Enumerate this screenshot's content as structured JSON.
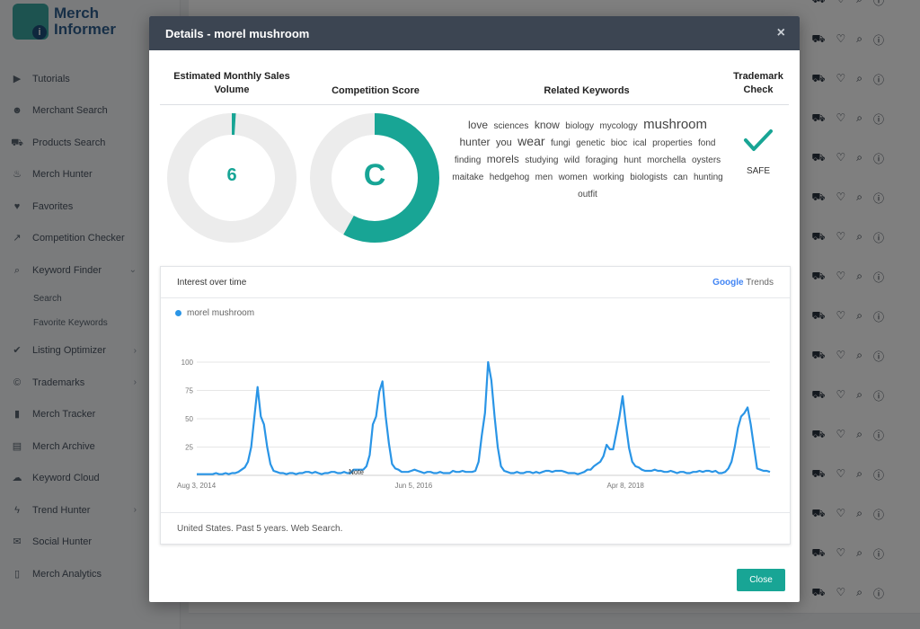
{
  "app": {
    "logo_line1": "Merch",
    "logo_line2": "Informer"
  },
  "sidebar": {
    "items": [
      {
        "label": "Tutorials",
        "icon": "video-icon"
      },
      {
        "label": "Merchant Search",
        "icon": "users-icon"
      },
      {
        "label": "Products Search",
        "icon": "cart-icon"
      },
      {
        "label": "Merch Hunter",
        "icon": "fire-icon"
      },
      {
        "label": "Favorites",
        "icon": "heart-icon"
      },
      {
        "label": "Competition Checker",
        "icon": "chart-line-icon"
      },
      {
        "label": "Keyword Finder",
        "icon": "search-icon",
        "arrow": "⌄"
      },
      {
        "label": "Listing Optimizer",
        "icon": "check-icon",
        "arrow": "›"
      },
      {
        "label": "Trademarks",
        "icon": "copyright-icon",
        "arrow": "›"
      },
      {
        "label": "Merch Tracker",
        "icon": "bar-chart-icon"
      },
      {
        "label": "Merch Archive",
        "icon": "archive-icon"
      },
      {
        "label": "Keyword Cloud",
        "icon": "cloud-icon"
      },
      {
        "label": "Trend Hunter",
        "icon": "bolt-icon",
        "arrow": "›"
      },
      {
        "label": "Social Hunter",
        "icon": "comments-icon"
      },
      {
        "label": "Merch Analytics",
        "icon": "book-icon"
      }
    ],
    "sub_items": [
      "Search",
      "Favorite Keywords"
    ]
  },
  "modal": {
    "title": "Details - morel mushroom",
    "close_icon": "×",
    "col_sales": "Estimated Monthly Sales Volume",
    "col_competition": "Competition Score",
    "col_keywords": "Related Keywords",
    "col_trademark": "Trademark Check",
    "sales_value": "6",
    "sales_fraction": 0.01,
    "competition_value": "C",
    "competition_fraction": 0.58,
    "keywords": [
      {
        "w": "love",
        "s": 12
      },
      {
        "w": "sciences",
        "s": 10
      },
      {
        "w": "know",
        "s": 12
      },
      {
        "w": "biology",
        "s": 10
      },
      {
        "w": "mycology",
        "s": 10
      },
      {
        "w": "mushroom",
        "s": 15
      },
      {
        "w": "hunter",
        "s": 12
      },
      {
        "w": "you",
        "s": 11
      },
      {
        "w": "wear",
        "s": 14
      },
      {
        "w": "fungi",
        "s": 10
      },
      {
        "w": "genetic",
        "s": 10
      },
      {
        "w": "bioc",
        "s": 10
      },
      {
        "w": "ical",
        "s": 10
      },
      {
        "w": "properties",
        "s": 10
      },
      {
        "w": "fond",
        "s": 10
      },
      {
        "w": "finding",
        "s": 10
      },
      {
        "w": "morels",
        "s": 12
      },
      {
        "w": "studying",
        "s": 10
      },
      {
        "w": "wild",
        "s": 10
      },
      {
        "w": "foraging",
        "s": 10
      },
      {
        "w": "hunt",
        "s": 10
      },
      {
        "w": "morchella",
        "s": 10
      },
      {
        "w": "oysters",
        "s": 10
      },
      {
        "w": "maitake",
        "s": 10
      },
      {
        "w": "hedgehog",
        "s": 10
      },
      {
        "w": "men",
        "s": 10
      },
      {
        "w": "women",
        "s": 10
      },
      {
        "w": "working",
        "s": 10
      },
      {
        "w": "biologists",
        "s": 10
      },
      {
        "w": "can",
        "s": 10
      },
      {
        "w": "hunting",
        "s": 10
      },
      {
        "w": "outfit",
        "s": 10
      }
    ],
    "trademark_status": "SAFE",
    "close_button": "Close"
  },
  "trends": {
    "title": "Interest over time",
    "brand": "Google",
    "brand_suffix": "Trends",
    "footer": "United States. Past 5 years. Web Search.",
    "note": "Note",
    "colors": {
      "line": "#2a95e6",
      "accent": "#18a595"
    }
  },
  "chart_data": {
    "type": "line",
    "title": "Interest over time",
    "series": [
      {
        "name": "morel mushroom",
        "values": [
          1,
          1,
          1,
          1,
          1,
          1,
          2,
          1,
          1,
          2,
          1,
          2,
          2,
          3,
          5,
          7,
          12,
          25,
          52,
          78,
          52,
          45,
          25,
          10,
          4,
          3,
          2,
          2,
          1,
          2,
          2,
          1,
          2,
          2,
          3,
          3,
          2,
          3,
          2,
          1,
          2,
          2,
          3,
          3,
          2,
          2,
          3,
          2,
          2,
          5,
          5,
          5,
          5,
          8,
          18,
          45,
          52,
          74,
          83,
          52,
          28,
          10,
          6,
          5,
          3,
          3,
          3,
          4,
          5,
          4,
          3,
          2,
          3,
          3,
          2,
          2,
          3,
          2,
          2,
          2,
          4,
          3,
          3,
          4,
          3,
          3,
          3,
          4,
          12,
          35,
          55,
          100,
          84,
          52,
          25,
          8,
          4,
          3,
          2,
          2,
          3,
          2,
          2,
          3,
          3,
          2,
          3,
          2,
          3,
          4,
          4,
          3,
          4,
          4,
          4,
          3,
          2,
          2,
          2,
          1,
          2,
          3,
          5,
          5,
          8,
          10,
          12,
          17,
          27,
          23,
          23,
          37,
          52,
          70,
          45,
          24,
          12,
          8,
          7,
          5,
          4,
          4,
          4,
          5,
          4,
          4,
          3,
          3,
          4,
          3,
          2,
          3,
          3,
          2,
          2,
          3,
          3,
          4,
          3,
          4,
          4,
          3,
          4,
          2,
          2,
          3,
          6,
          12,
          25,
          42,
          52,
          55,
          60,
          45,
          25,
          6,
          5,
          4,
          4,
          3
        ]
      }
    ],
    "x_ticks": [
      "Aug 3, 2014",
      "Jun 5, 2016",
      "Apr 8, 2018"
    ],
    "y_ticks": [
      25,
      50,
      75,
      100
    ],
    "ylim": [
      0,
      100
    ],
    "grid": true
  }
}
